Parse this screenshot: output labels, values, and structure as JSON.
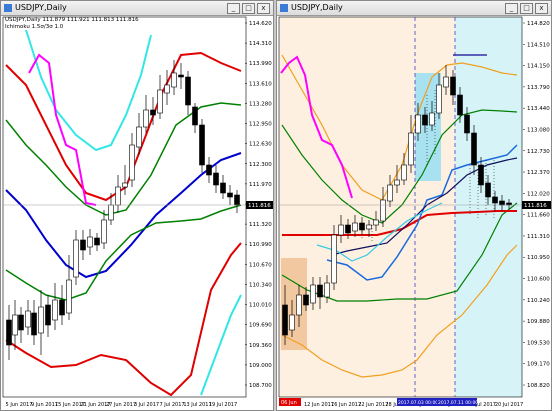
{
  "left": {
    "title": "USDJPY,Daily",
    "ohlc_line": "USDJPY,Daily  111.879 111.921 111.813 111.816",
    "indicator_line": "Ichimoku 1.5σ/3σ 1.0",
    "price_labels": [
      "114.620",
      "114.310",
      "113.990",
      "113.610",
      "113.280",
      "112.950",
      "112.630",
      "112.300",
      "111.970",
      "111.650",
      "111.320",
      "110.990",
      "110.670",
      "110.340",
      "110.010",
      "109.690",
      "109.360",
      "109.000",
      "108.700"
    ],
    "current_price": "111.816",
    "date_labels": [
      "5 Jun 2017",
      "9 Jun 2017",
      "15 Jun 2017",
      "21 Jun 2017",
      "27 Jun 2017",
      "3 Jul 2017",
      "7 Jul 2017",
      "13 Jul 2017",
      "19 Jul 2017"
    ]
  },
  "right": {
    "title": "USDJPY,Daily",
    "ohlc_line": "USDJPY,Daily  111.879 111.921 111.813 111.816",
    "price_labels": [
      "114.820",
      "114.510",
      "114.150",
      "113.790",
      "113.440",
      "113.080",
      "112.730",
      "112.370",
      "112.020",
      "111.660",
      "111.310",
      "110.950",
      "110.600",
      "110.240",
      "109.880",
      "109.530",
      "109.170",
      "108.820"
    ],
    "current_price": "111.816",
    "date_labels": [
      "12 Jun 2017",
      "16 Jun 2017",
      "22 Jun 2017",
      "28 Jun 2017",
      "4 Jul 2017",
      "10 Jul 2017",
      "14 Jul 2017",
      "20 Jul 2017"
    ],
    "vline_tags": [
      "2017.07.03 00:00",
      "2017.07.11 00:00"
    ],
    "corner_tag": "06 Jun"
  },
  "buttons": {
    "minimize": "_",
    "maximize": "□",
    "close": "x"
  },
  "colors": {
    "bull": "#ffffff",
    "bear": "#000000",
    "bb_outer": "#e00000",
    "bb_mid": "#008000",
    "ma_blue": "#0000d0",
    "cyan": "#33e6e6",
    "magenta": "#ff00ff",
    "orange": "#f0a020"
  }
}
